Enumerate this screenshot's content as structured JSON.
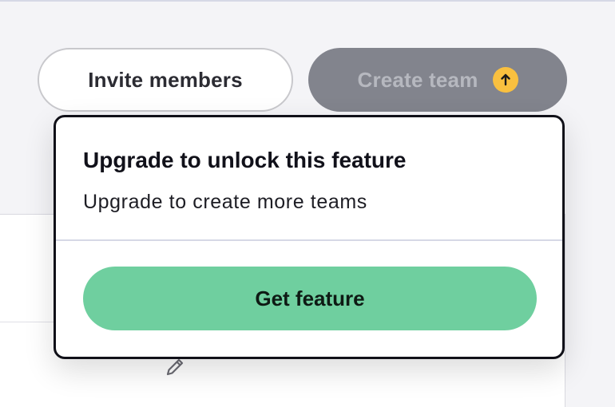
{
  "toolbar": {
    "invite_label": "Invite members",
    "create_team_label": "Create team",
    "upgrade_badge_icon": "arrow-up-icon"
  },
  "popover": {
    "title": "Upgrade to unlock this feature",
    "description": "Upgrade to create more teams",
    "cta_label": "Get feature"
  },
  "table": {
    "row_action_icon": "pencil-icon"
  },
  "colors": {
    "page_bg": "#f4f4f7",
    "create_button_bg": "#82848d",
    "upgrade_badge": "#f9c03f",
    "cta_bg": "#6fcf9f",
    "popover_border": "#101018"
  }
}
